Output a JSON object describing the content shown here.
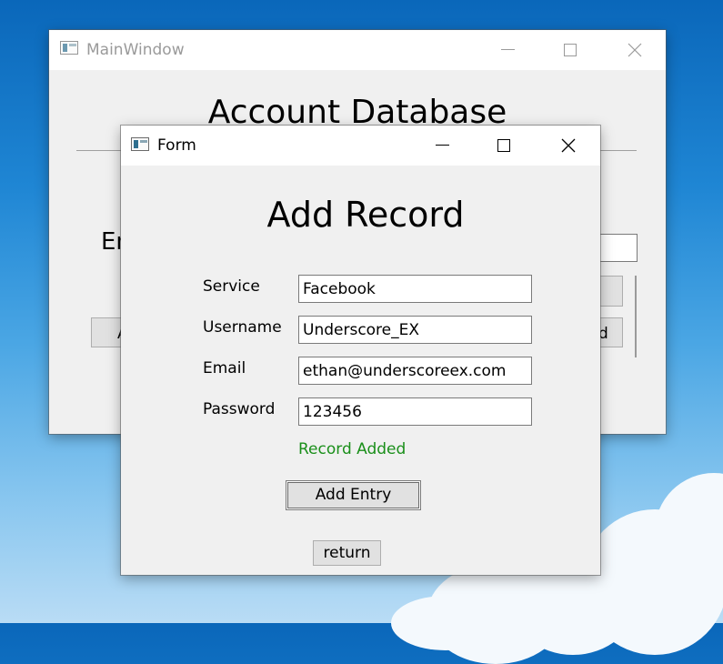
{
  "main_window": {
    "title": "MainWindow",
    "heading": "Account Database",
    "partial_label": "En",
    "partial_button_left": "A",
    "partial_button_right": "d"
  },
  "form_window": {
    "title": "Form",
    "heading": "Add Record",
    "fields": [
      {
        "label": "Service",
        "value": "Facebook"
      },
      {
        "label": "Username",
        "value": "Underscore_EX"
      },
      {
        "label": "Email",
        "value": "ethan@underscoreex.com"
      },
      {
        "label": "Password",
        "value": "123456"
      }
    ],
    "status_message": "Record Added",
    "status_color": "#1a8f1a",
    "add_button": "Add Entry",
    "return_button": "return"
  },
  "icons": {
    "app_icon": "qt-window-icon",
    "minimize": "minimize-icon",
    "maximize": "maximize-icon",
    "close": "close-icon"
  }
}
